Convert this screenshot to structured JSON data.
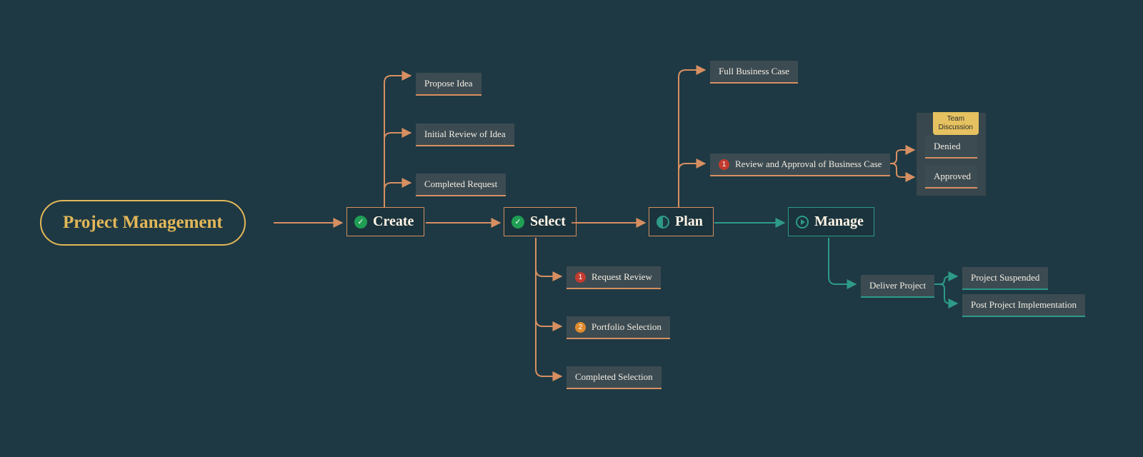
{
  "root": {
    "title": "Project Management"
  },
  "stages": {
    "create": "Create",
    "select": "Select",
    "plan": "Plan",
    "manage": "Manage"
  },
  "create_items": {
    "propose": "Propose Idea",
    "initial": "Initial Review of Idea",
    "completed": "Completed Request"
  },
  "select_items": {
    "review": "Request Review",
    "portfolio": "Portfolio Selection",
    "completed": "Completed Selection"
  },
  "plan_items": {
    "case": "Full Business Case",
    "review": "Review and Approval of Business Case"
  },
  "review_group": {
    "tag1": "Team",
    "tag2": "Discussion",
    "denied": "Denied",
    "approved": "Approved"
  },
  "manage_items": {
    "deliver": "Deliver Project",
    "suspended": "Project Suspended",
    "post": "Post Project Implementation"
  },
  "bullets": {
    "one": "1",
    "two": "2"
  },
  "checks": {
    "done": "✓"
  },
  "colors": {
    "background": "#1e3943",
    "accent": "#e3b758",
    "connector": "#d78f61",
    "teal": "#2e9a88",
    "leaf_bg": "#3c4b52"
  }
}
